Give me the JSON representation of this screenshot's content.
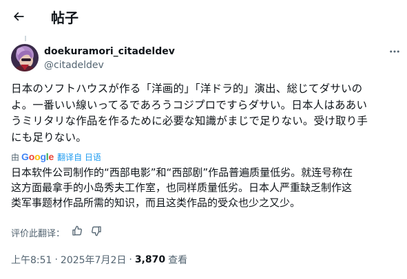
{
  "header": {
    "back_label": "back",
    "title": "帖子"
  },
  "post": {
    "author": {
      "name": "doekuramori_citadeldev",
      "handle": "@citadeldev"
    },
    "original_lines": [
      "日本のソフトハウスが作る「洋画的」「洋ドラ的」演出、総じてダサいの",
      "よ。一番いい線いってるであろうコジプロですらダサい。日本人はああい",
      "うミリタリな作品を作るために必要な知識がまじで足りない。受け取り手",
      "にも足りない。"
    ],
    "translation": {
      "by_label": "由",
      "provider": "Google",
      "link_label": "翻译自 日语",
      "lines": [
        "日本软件公司制作的“西部电影”和“西部剧”作品普遍质量低劣。就连号称在",
        "这方面最拿手的小岛秀夫工作室，也同样质量低劣。日本人严重缺乏制作这",
        "类军事题材作品所需的知识，而且这类作品的受众也少之又少。"
      ],
      "rate_label": "评价此翻译："
    },
    "meta": {
      "time": "上午8:51",
      "separator": "·",
      "date": "2025年7月2日",
      "views_count": "3,870",
      "views_label": "查看"
    }
  },
  "icons": {
    "back": "arrow-left-icon",
    "more": "more-horizontal-icon",
    "thumbs_up": "thumbs-up-icon",
    "thumbs_down": "thumbs-down-icon"
  },
  "colors": {
    "text": "#0f1419",
    "secondary": "#536471",
    "link": "#1d9bf0",
    "thread_line": "#cfd9de"
  }
}
